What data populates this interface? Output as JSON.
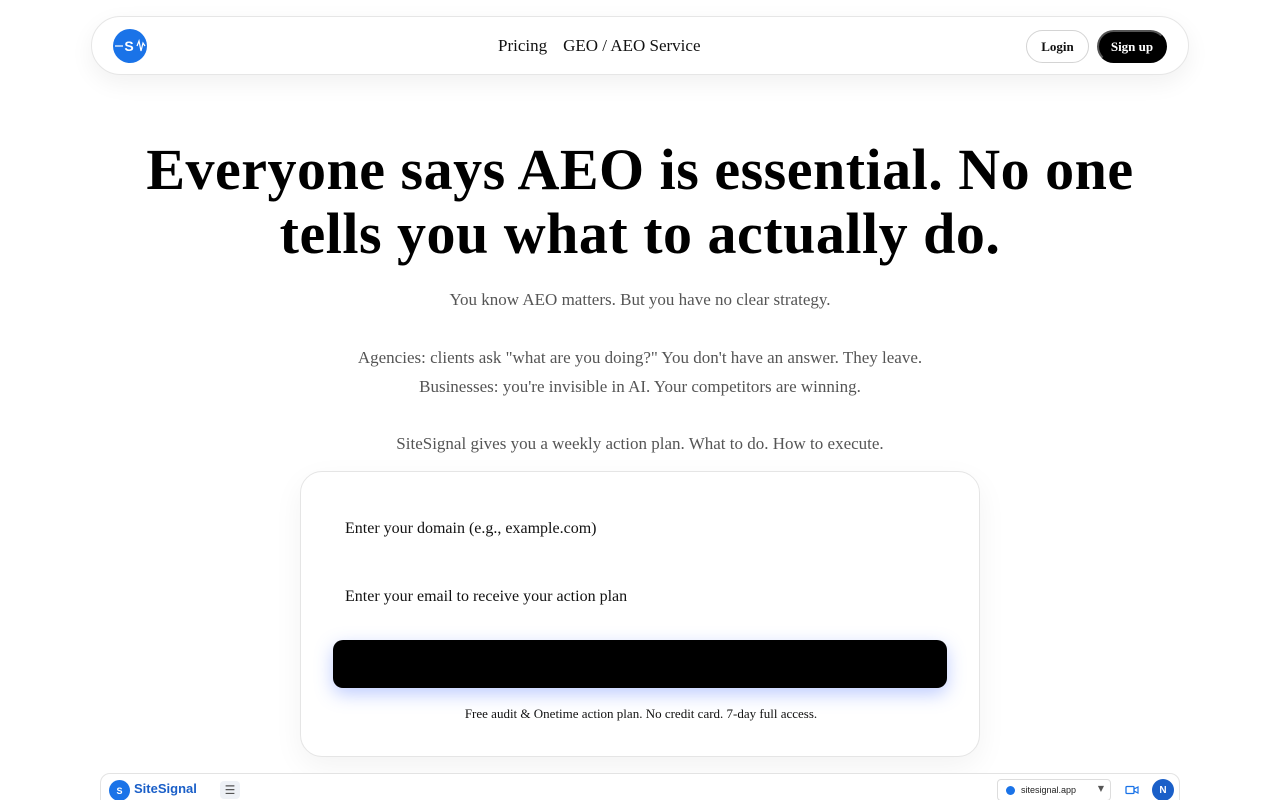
{
  "nav": {
    "logo_letter": "S",
    "links": [
      "Pricing",
      "GEO / AEO Service"
    ],
    "login_label": "Login",
    "signup_label": "Sign up"
  },
  "hero": {
    "title_line1": "Everyone says AEO is essential. No one",
    "title_line2": "tells you what to actually do.",
    "sub1": "You know AEO matters. But you have no clear strategy.",
    "sub2": "Agencies: clients ask \"what are you doing?\" You don't have an answer. They leave.",
    "sub3": "Businesses: you're invisible in AI. Your competitors are winning.",
    "sub4": "SiteSignal gives you a weekly action plan. What to do. How to execute."
  },
  "form": {
    "domain_placeholder": "Enter your domain (e.g., example.com)",
    "email_placeholder": "Enter your email to receive your action plan",
    "submit_label": "",
    "note": "Free audit & Onetime action plan. No credit card. 7-day full access."
  },
  "preview": {
    "logo_letter": "S",
    "brand": "SiteSignal",
    "site_selector": "sitesignal.app",
    "avatar_letter": "N"
  },
  "colors": {
    "brand_blue": "#1a73e8",
    "button_black": "#000000"
  }
}
